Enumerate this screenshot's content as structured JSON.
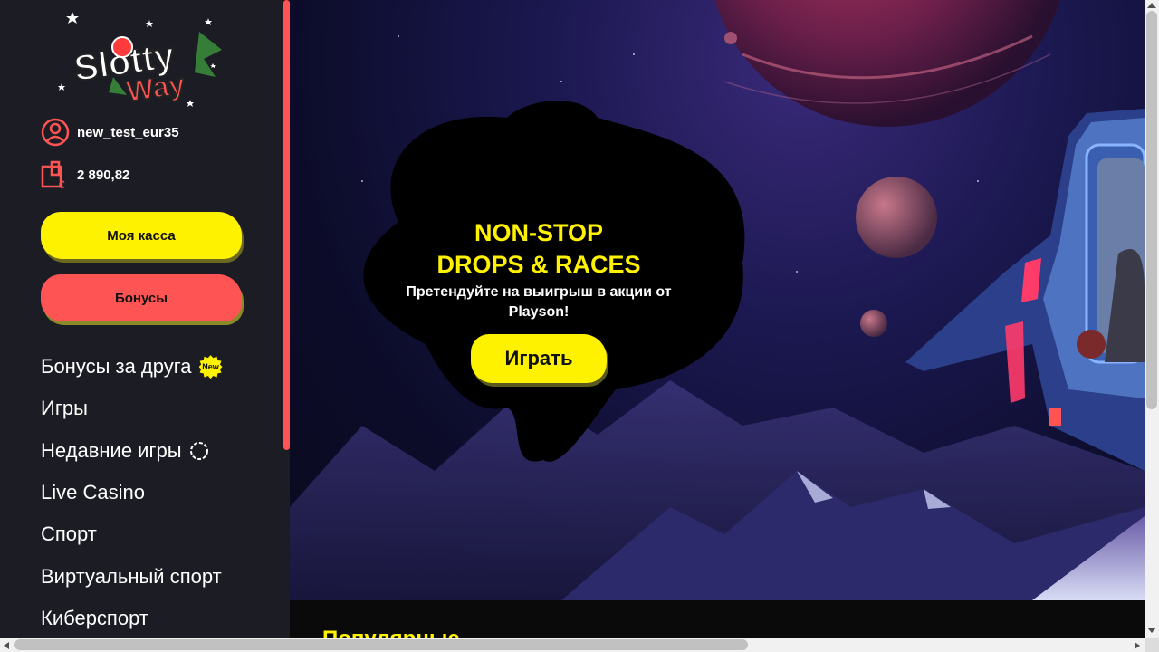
{
  "brand": {
    "logo_top": "Slotty",
    "logo_bottom": "Way"
  },
  "user": {
    "username": "new_test_eur35",
    "balance": "2 890,82",
    "currency_symbol": "€"
  },
  "buttons": {
    "cashier": "Моя касса",
    "bonuses": "Бонусы"
  },
  "nav": {
    "items": [
      {
        "label": "Бонусы за друга",
        "badge": "New"
      },
      {
        "label": "Игры"
      },
      {
        "label": "Недавние игры"
      },
      {
        "label": "Live Casino"
      },
      {
        "label": "Спорт"
      },
      {
        "label": "Виртуальный спорт"
      },
      {
        "label": "Киберспорт"
      }
    ]
  },
  "promo": {
    "title_line1": "NON-STOP",
    "title_line2": "DROPS & RACES",
    "subtitle": "Претендуйте на выигрыш в акции от Playson!",
    "cta": "Играть"
  },
  "section": {
    "title": "Популярные"
  },
  "colors": {
    "accent_yellow": "#fff200",
    "accent_red": "#ff5454",
    "sidebar_bg": "#1c1d24"
  }
}
